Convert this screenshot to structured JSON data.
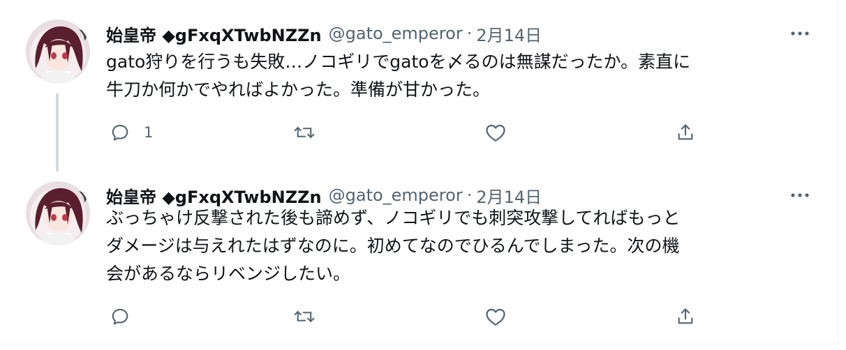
{
  "tweets": [
    {
      "display_name": "始皇帝 ◆gFxqXTwbNZZn",
      "handle": "@gato_emperor",
      "separator": "·",
      "date": "2月14日",
      "text": "gato狩りを行うも失敗…ノコギリでgatoを〆るのは無謀だったか。素直に\n牛刀か何かでやればよかった。準備が甘かった。",
      "reply_count": "1",
      "avatar_icon": "avatar-anime-girl"
    },
    {
      "display_name": "始皇帝 ◆gFxqXTwbNZZn",
      "handle": "@gato_emperor",
      "separator": "·",
      "date": "2月14日",
      "text": "ぶっちゃけ反撃された後も諦めず、ノコギリでも刺突攻撃してればもっと\nダメージは与えれたはずなのに。初めてなのでひるんでしまった。次の機\n会があるならリベンジしたい。",
      "reply_count": "",
      "avatar_icon": "avatar-anime-girl"
    }
  ],
  "icons": {
    "more": "more-horizontal-icon",
    "reply": "reply-bubble-icon",
    "retweet": "retweet-arrows-icon",
    "like": "heart-outline-icon",
    "share": "share-upload-icon"
  },
  "colors": {
    "text": "#0f1419",
    "secondary": "#536471",
    "thread_line": "#cfd9de",
    "border": "#eff3f4"
  }
}
